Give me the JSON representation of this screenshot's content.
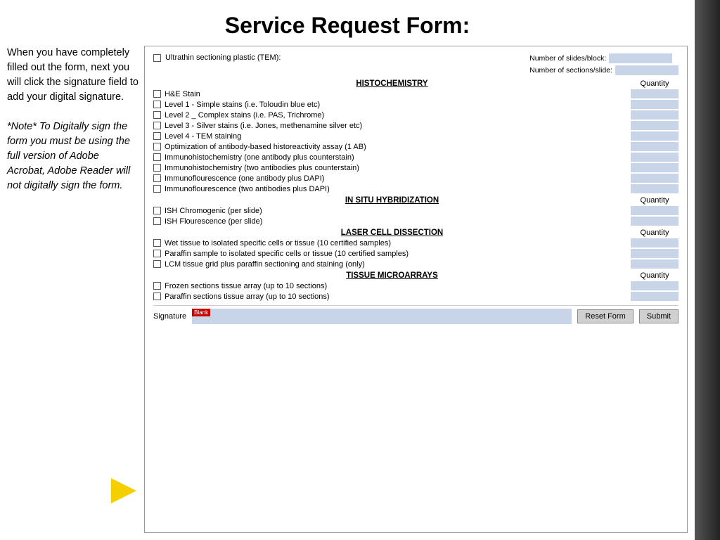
{
  "title": "Service Request Form:",
  "sidebar": {
    "paragraph1": "When you have completely filled out the form, next you will click the signature field to add your digital signature.",
    "paragraph2": "*Note* To Digitally sign the form you must be using the full version of Adobe Acrobat, Adobe Reader will not digitally sign the form."
  },
  "form": {
    "top": {
      "label": "Ultrathin sectioning plastic (TEM):",
      "num_slides_label": "Number of slides/block:",
      "num_sections_label": "Number of sections/slide:"
    },
    "histochemistry": {
      "header": "HISTOCHEMISTRY",
      "qty_label": "Quantity",
      "items": [
        "H&E Stain",
        "Level 1 - Simple stains (i.e. Toloudin blue etc)",
        "Level 2 _ Complex stains (i.e. PAS, Trichrome)",
        "Level 3 - Silver stains (i.e. Jones, methenamine silver etc)",
        "Level 4 - TEM staining",
        "Optimization of antibody-based historeactivity assay (1 AB)",
        "Immunohistochemistry (one antibody plus counterstain)",
        "Immunohistochemistry (two antibodies plus counterstain)",
        "Immunoflourescence (one antibody plus DAPI)",
        "Immunoflourescence (two antibodies plus DAPI)"
      ]
    },
    "in_situ": {
      "header": "IN SITU HYBRIDIZATION",
      "qty_label": "Quantity",
      "items": [
        "ISH Chromogenic (per slide)",
        "ISH Flourescence (per slide)"
      ]
    },
    "laser": {
      "header": "LASER CELL DISSECTION",
      "qty_label": "Quantity",
      "items": [
        "Wet tissue to isolated specific cells or tissue (10 certified samples)",
        "Paraffin sample to isolated specific cells or tissue (10 certified samples)",
        "LCM tissue grid plus paraffin sectioning and staining (only)"
      ]
    },
    "tissue": {
      "header": "TISSUE MICROARRAYS",
      "qty_label": "Quantity",
      "items": [
        "Frozen sections tissue array (up to 10 sections)",
        "Paraffin sections tissue array (up to 10 sections)"
      ]
    },
    "signature": {
      "label": "Signature",
      "required_badge": "Blank",
      "reset_btn": "Reset Form",
      "submit_btn": "Submit"
    }
  }
}
